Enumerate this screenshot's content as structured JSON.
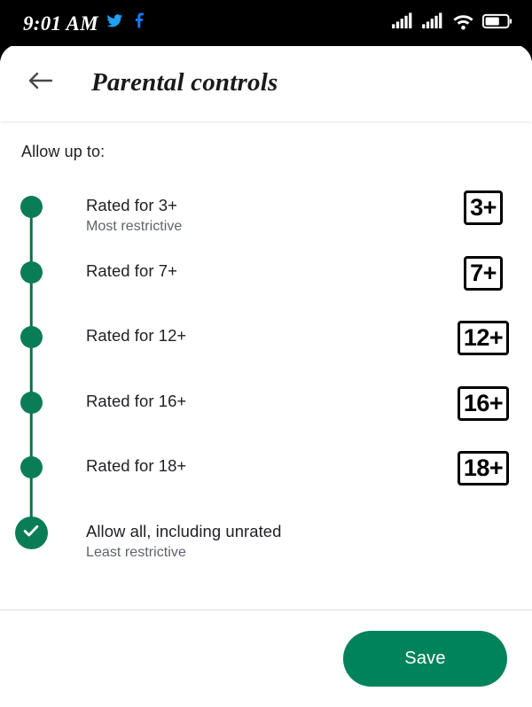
{
  "status_bar": {
    "time": "9:01 AM",
    "icons": [
      "twitter-icon",
      "facebook-icon",
      "signal-icon",
      "signal-icon-2",
      "wifi-icon",
      "battery-icon"
    ],
    "battery_level_percent": 60,
    "twitter_color": "#1DA1F2",
    "facebook_color": "#1877F2",
    "background": "#000000"
  },
  "app_bar": {
    "back_label": "back-arrow",
    "title": "Parental controls"
  },
  "content": {
    "section_label": "Allow up to:",
    "accent_color": "#0a7d56",
    "options": [
      {
        "title": "Rated for 3+",
        "subtitle": "Most restrictive",
        "badge": "3+",
        "selected": false
      },
      {
        "title": "Rated for 7+",
        "subtitle": "",
        "badge": "7+",
        "selected": false
      },
      {
        "title": "Rated for 12+",
        "subtitle": "",
        "badge": "12+",
        "selected": false
      },
      {
        "title": "Rated for 16+",
        "subtitle": "",
        "badge": "16+",
        "selected": false
      },
      {
        "title": "Rated for 18+",
        "subtitle": "",
        "badge": "18+",
        "selected": false
      },
      {
        "title": "Allow all, including unrated",
        "subtitle": "Least restrictive",
        "badge": "",
        "selected": true
      }
    ]
  },
  "footer": {
    "save_label": "Save",
    "save_color": "#00835a"
  }
}
